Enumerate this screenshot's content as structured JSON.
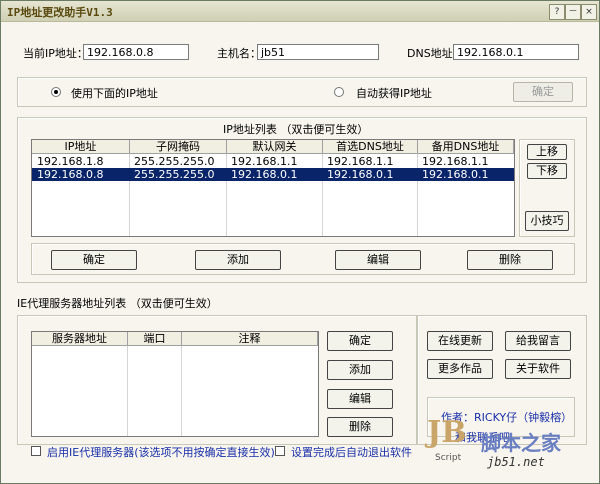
{
  "window": {
    "title": "IP地址更改助手V1.3",
    "help": "?",
    "minimize": "－",
    "close": "×"
  },
  "header": {
    "ip_label": "当前IP地址：",
    "ip_value": "192.168.0.8",
    "host_label": "主机名：",
    "host_value": "jb51",
    "dns_label": "DNS地址：",
    "dns_value": "192.168.0.1"
  },
  "mode": {
    "manual_label": "使用下面的IP地址",
    "auto_label": "自动获得IP地址",
    "confirm_label": "确定",
    "selected": "manual"
  },
  "ip_list": {
    "title": "IP地址列表 （双击便可生效）",
    "columns": [
      "IP地址",
      "子网掩码",
      "默认网关",
      "首选DNS地址",
      "备用DNS地址"
    ],
    "rows": [
      [
        "192.168.1.8",
        "255.255.255.0",
        "192.168.1.1",
        "192.168.1.1",
        "192.168.1.1"
      ],
      [
        "192.168.0.8",
        "255.255.255.0",
        "192.168.0.1",
        "192.168.0.1",
        "192.168.0.1"
      ]
    ],
    "selected_row": 1,
    "up_label": "上移",
    "down_label": "下移",
    "tips_label": "小技巧",
    "buttons": {
      "ok": "确定",
      "add": "添加",
      "edit": "编辑",
      "delete": "删除"
    }
  },
  "proxy": {
    "title": "IE代理服务器地址列表 （双击便可生效）",
    "columns": [
      "服务器地址",
      "端口",
      "注释"
    ],
    "buttons": {
      "ok": "确定",
      "add": "添加",
      "edit": "编辑",
      "delete": "删除"
    },
    "enable_label": "启用IE代理服务器(该选项不用按确定直接生效)",
    "exit_label": "设置完成后自动退出软件"
  },
  "side": {
    "online_update": "在线更新",
    "leave_message": "给我留言",
    "more_works": "更多作品",
    "about": "关于软件",
    "author": "作者：RICKY仔（钟毅榕）",
    "author_line2": "和我联系吧"
  },
  "watermark": {
    "site": "脚本之家",
    "url": "jb51.net",
    "logo": "JB",
    "logo_sub": "Script"
  }
}
